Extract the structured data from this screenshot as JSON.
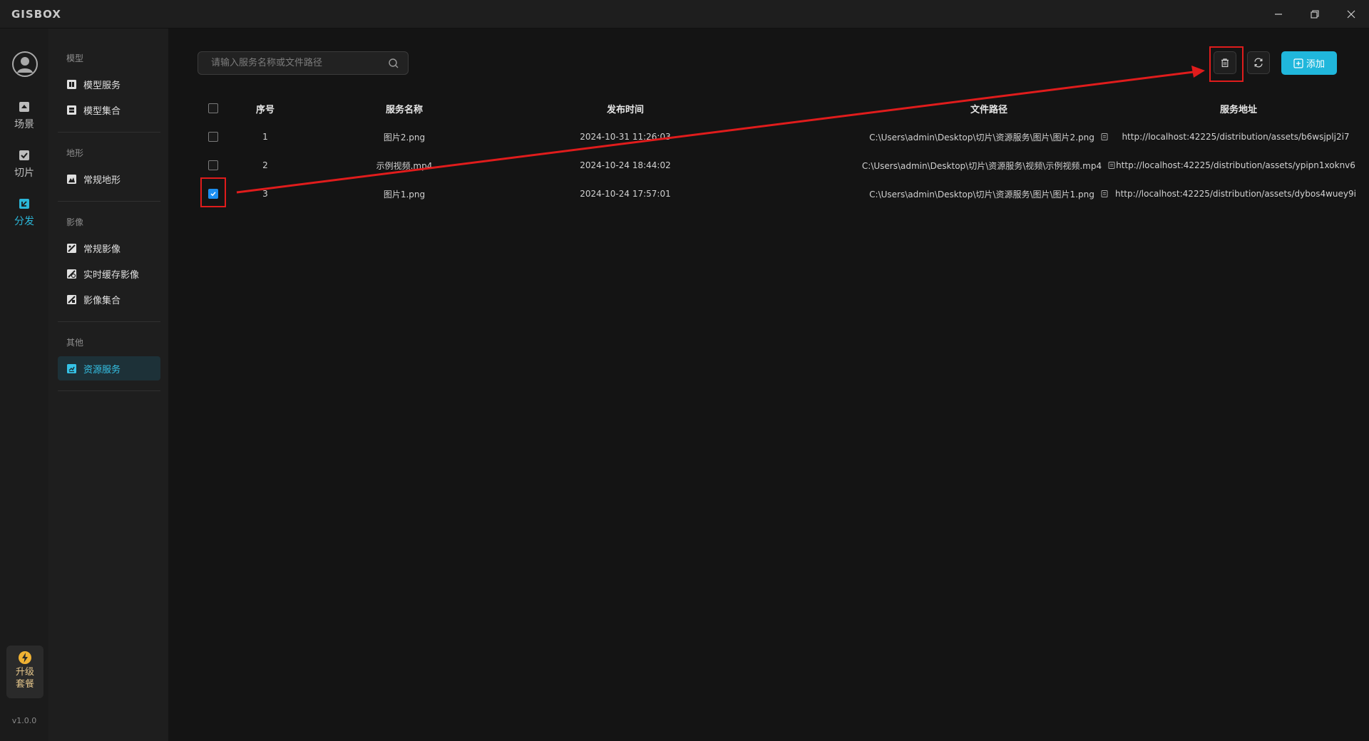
{
  "app": {
    "brand": "GISBOX"
  },
  "rail": {
    "items": [
      {
        "label": "场景",
        "icon": "scene-icon"
      },
      {
        "label": "切片",
        "icon": "slice-icon"
      },
      {
        "label": "分发",
        "icon": "distribute-icon",
        "active": true
      }
    ],
    "upgrade": {
      "line1": "升级",
      "line2": "套餐",
      "icon": "lightning-icon"
    },
    "version": "v1.0.0"
  },
  "subnav": {
    "groups": [
      {
        "title": "模型",
        "items": [
          {
            "label": "模型服务"
          },
          {
            "label": "模型集合"
          }
        ]
      },
      {
        "title": "地形",
        "items": [
          {
            "label": "常规地形"
          }
        ]
      },
      {
        "title": "影像",
        "items": [
          {
            "label": "常规影像"
          },
          {
            "label": "实时缓存影像"
          },
          {
            "label": "影像集合"
          }
        ]
      },
      {
        "title": "其他",
        "items": [
          {
            "label": "资源服务",
            "active": true
          }
        ]
      }
    ]
  },
  "toolbar": {
    "search_placeholder": "请输入服务名称或文件路径",
    "add_label": "添加"
  },
  "table": {
    "headers": {
      "index": "序号",
      "name": "服务名称",
      "time": "发布时间",
      "path": "文件路径",
      "url": "服务地址"
    },
    "rows": [
      {
        "checked": false,
        "index": "1",
        "name": "图片2.png",
        "time": "2024-10-31 11:26:03",
        "path": "C:\\Users\\admin\\Desktop\\切片\\资源服务\\图片\\图片2.png",
        "url": "http://localhost:42225/distribution/assets/b6wsjplj2i7"
      },
      {
        "checked": false,
        "index": "2",
        "name": "示例视频.mp4",
        "time": "2024-10-24 18:44:02",
        "path": "C:\\Users\\admin\\Desktop\\切片\\资源服务\\视频\\示例视频.mp4",
        "url": "http://localhost:42225/distribution/assets/ypipn1xoknv6"
      },
      {
        "checked": true,
        "index": "3",
        "name": "图片1.png",
        "time": "2024-10-24 17:57:01",
        "path": "C:\\Users\\admin\\Desktop\\切片\\资源服务\\图片\\图片1.png",
        "url": "http://localhost:42225/distribution/assets/dybos4wuey9i"
      }
    ]
  },
  "colors": {
    "accent": "#20b7dc",
    "annotation": "#e01c1c",
    "checkbox": "#1d8ff0"
  }
}
